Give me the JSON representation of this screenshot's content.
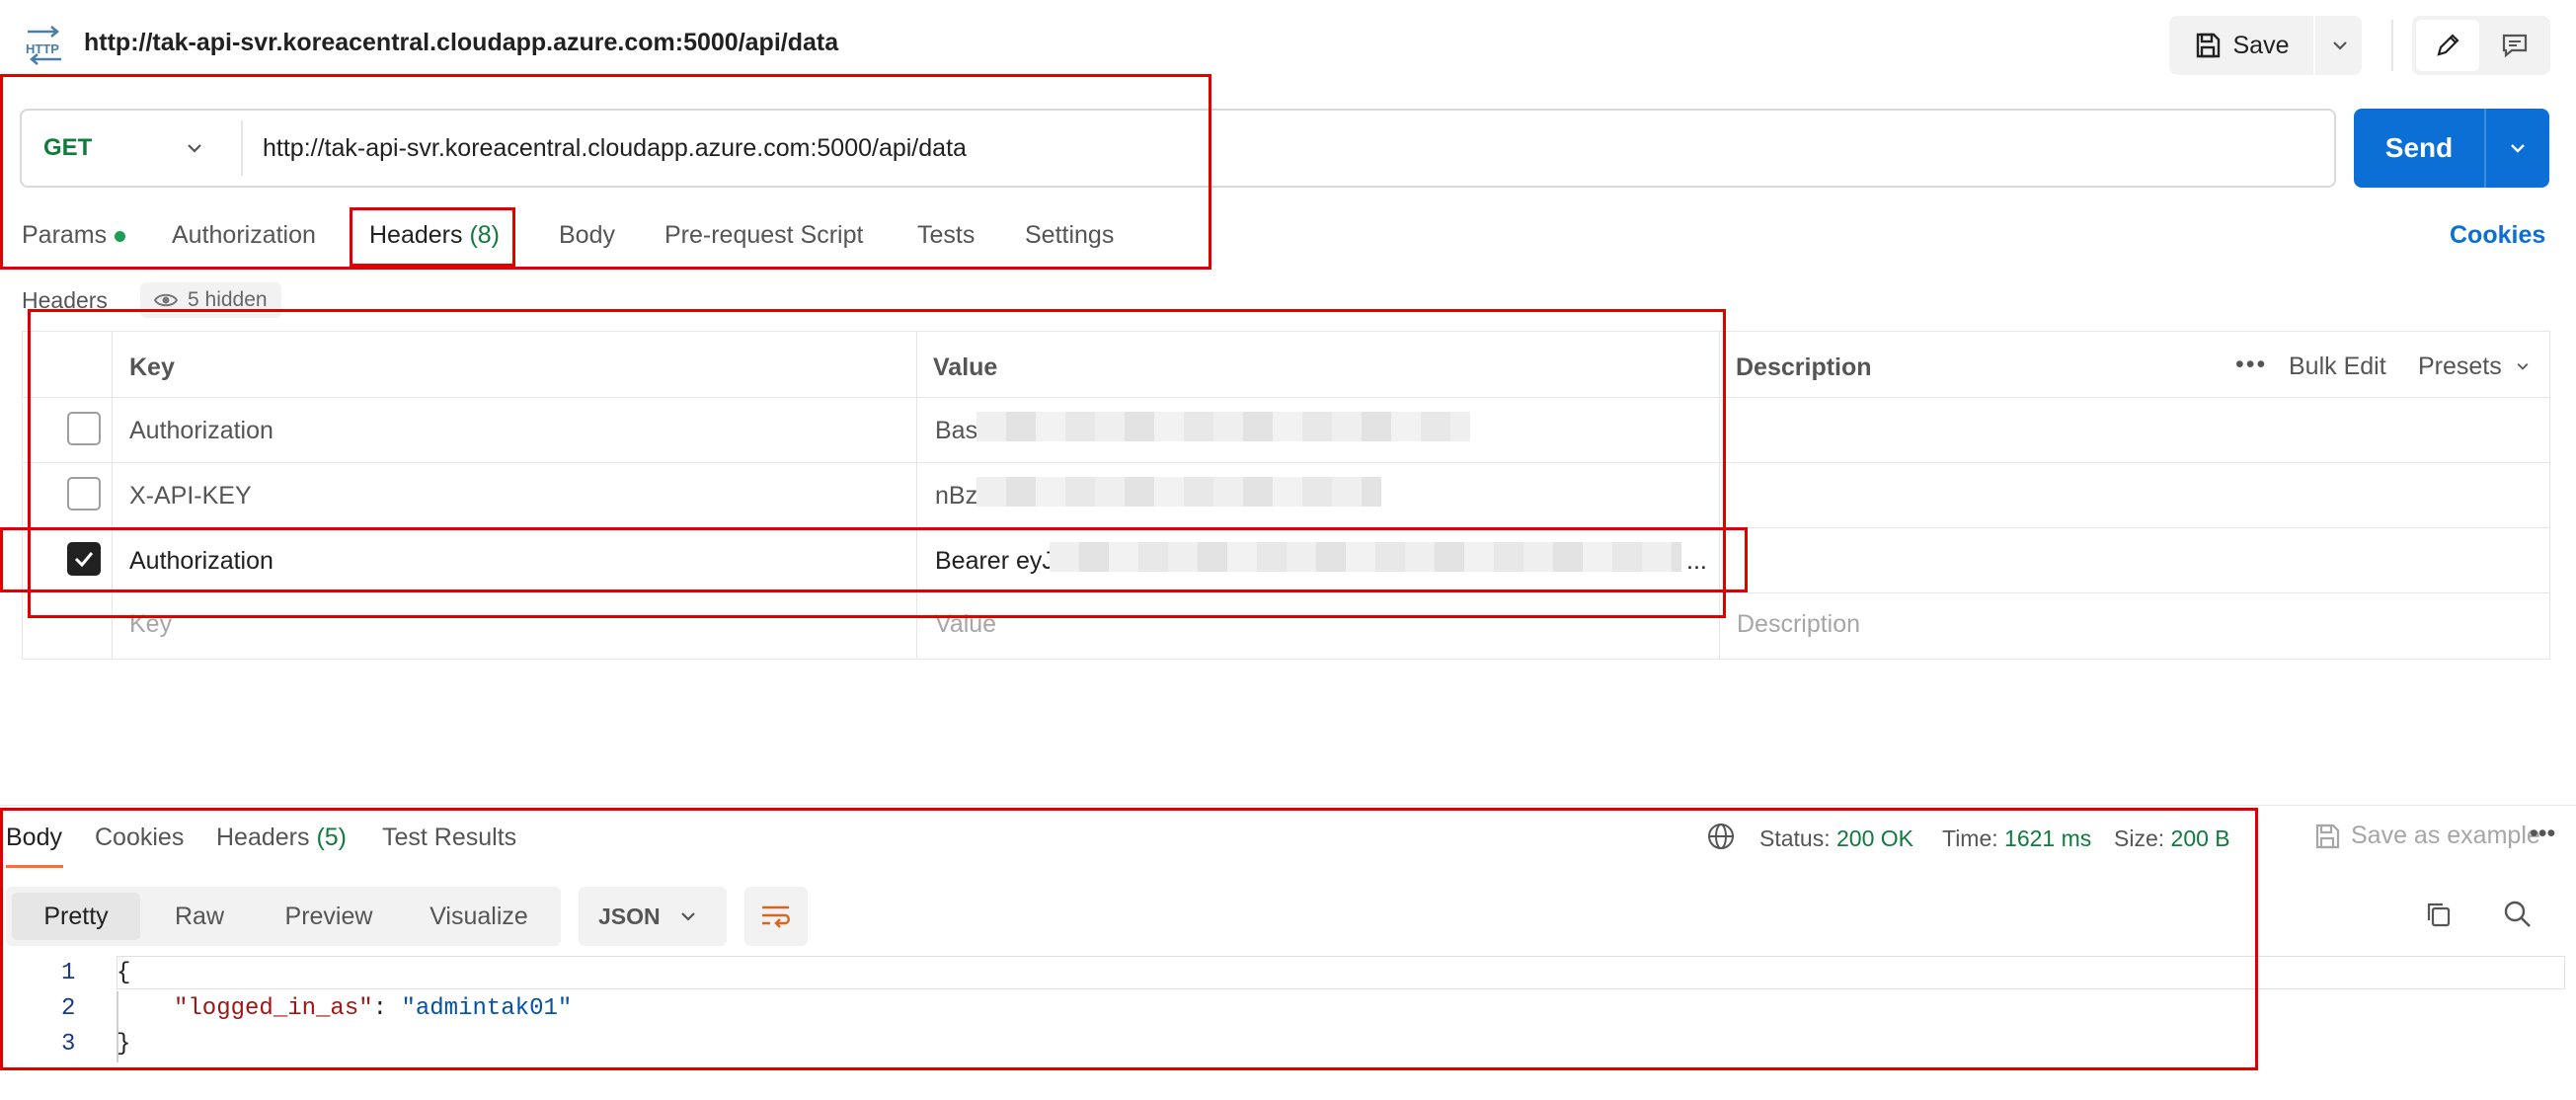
{
  "top": {
    "icon_label": "HTTP",
    "title": "http://tak-api-svr.koreacentral.cloudapp.azure.com:5000/api/data",
    "save_label": "Save"
  },
  "request": {
    "method": "GET",
    "url": "http://tak-api-svr.koreacentral.cloudapp.azure.com:5000/api/data",
    "send_label": "Send"
  },
  "tabs": {
    "params": "Params",
    "authorization": "Authorization",
    "headers": "Headers",
    "headers_count": "(8)",
    "body": "Body",
    "prerequest": "Pre-request Script",
    "tests": "Tests",
    "settings": "Settings",
    "cookies": "Cookies"
  },
  "headers_section": {
    "label": "Headers",
    "hidden": "5 hidden",
    "columns": {
      "key": "Key",
      "value": "Value",
      "description": "Description"
    },
    "more": "•••",
    "bulk_edit": "Bulk Edit",
    "presets": "Presets",
    "rows": [
      {
        "key": "Authorization",
        "value": "Bas",
        "checked": false
      },
      {
        "key": "X-API-KEY",
        "value": "nBz",
        "checked": false
      },
      {
        "key": "Authorization",
        "value": "Bearer eyJ",
        "value_suffix": "...",
        "checked": true
      }
    ],
    "placeholder": {
      "key": "Key",
      "value": "Value",
      "description": "Description"
    }
  },
  "response": {
    "tabs": {
      "body": "Body",
      "cookies": "Cookies",
      "headers": "Headers",
      "headers_count": "(5)",
      "test_results": "Test Results"
    },
    "status_label": "Status:",
    "status_value": "200 OK",
    "time_label": "Time:",
    "time_value": "1621 ms",
    "size_label": "Size:",
    "size_value": "200 B",
    "save_example": "Save as example",
    "more": "•••",
    "views": [
      "Pretty",
      "Raw",
      "Preview",
      "Visualize"
    ],
    "format": "JSON",
    "code": {
      "line1": "{",
      "key": "\"logged_in_as\"",
      "colon": ": ",
      "value": "\"admintak01\"",
      "line3": "}",
      "line_numbers": [
        "1",
        "2",
        "3"
      ]
    }
  },
  "colors": {
    "accent": "#0b6fd6",
    "success": "#0f7b3c",
    "highlight": "#e00000",
    "active_tab": "#ff6c37"
  }
}
